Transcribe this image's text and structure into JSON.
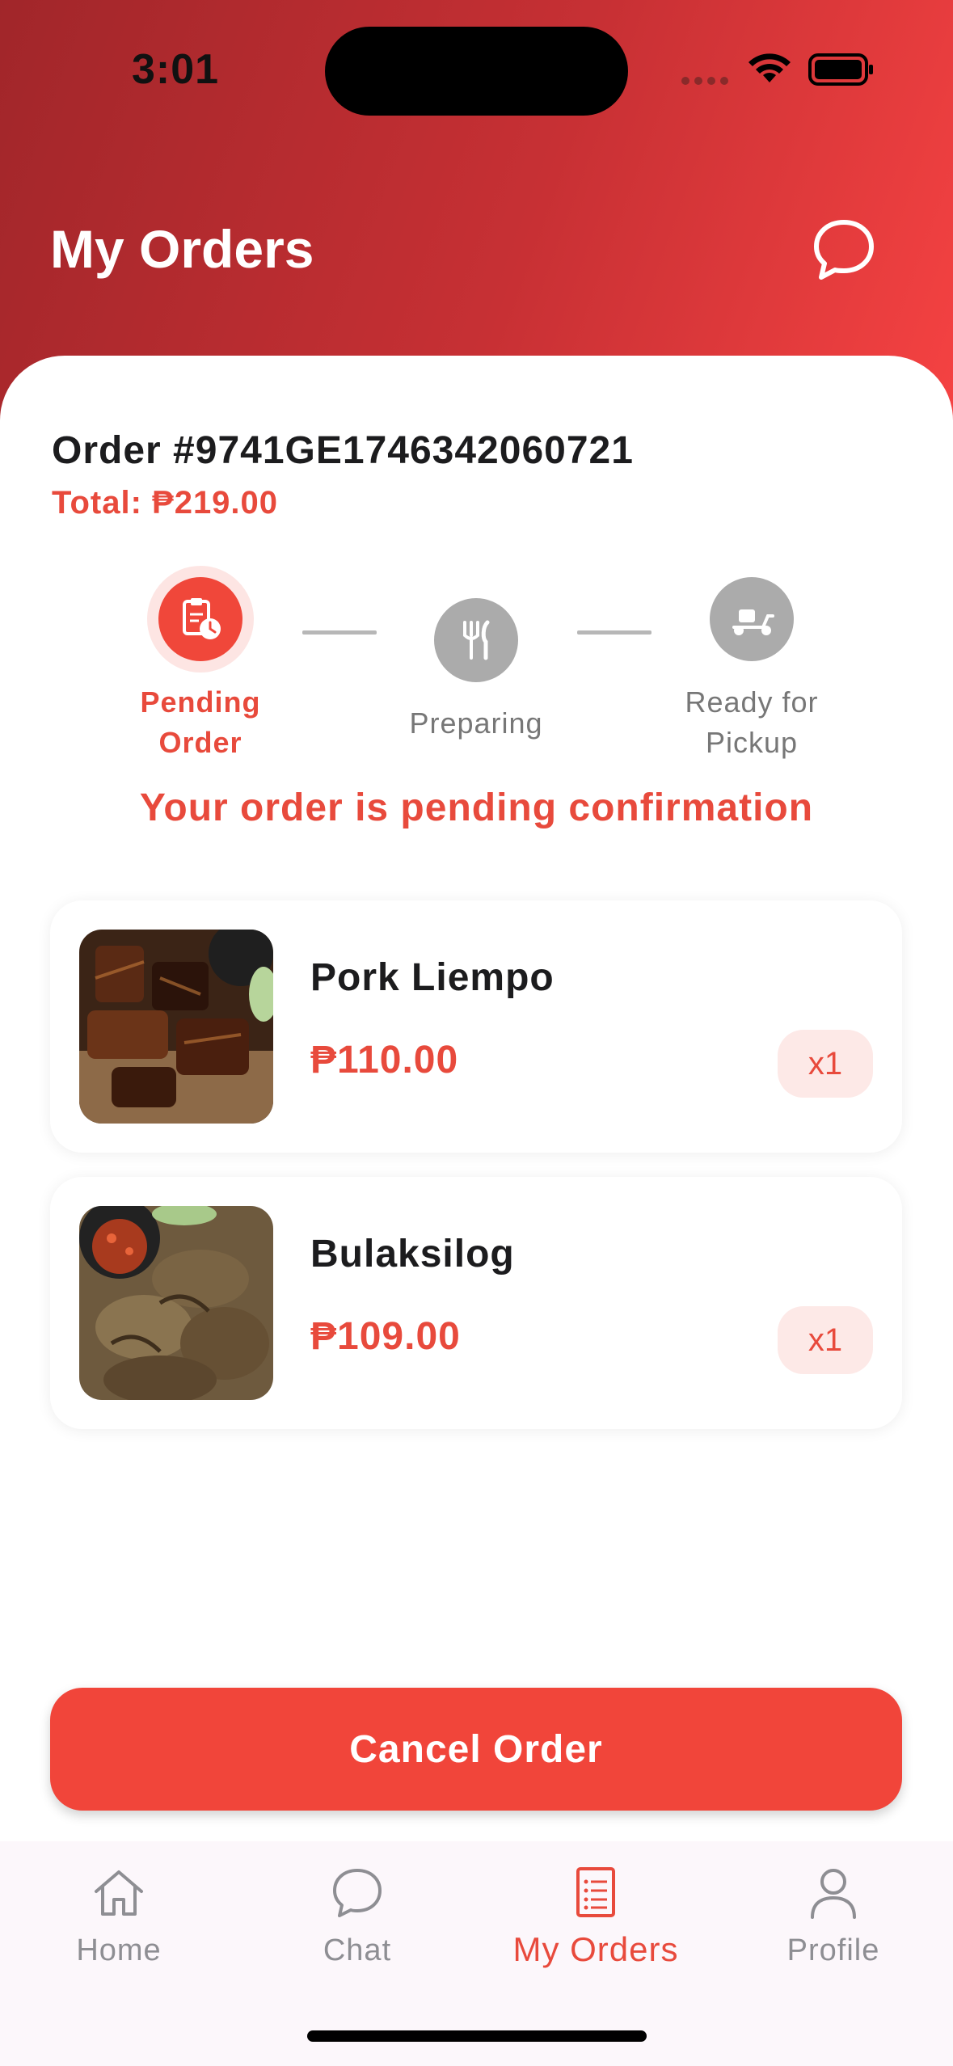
{
  "status_bar": {
    "time": "3:01"
  },
  "header": {
    "title": "My Orders",
    "chat_icon": "chat-bubble-icon"
  },
  "order": {
    "number_label": "Order #9741GE1746342060721",
    "total_label": "Total: ₱219.00"
  },
  "progress": {
    "steps": [
      {
        "label_line1": "Pending",
        "label_line2": "Order",
        "icon": "clipboard-clock-icon",
        "state": "active"
      },
      {
        "label_line1": "Preparing",
        "label_line2": "",
        "icon": "fork-knife-icon",
        "state": "idle"
      },
      {
        "label_line1": "Ready for",
        "label_line2": "Pickup",
        "icon": "scooter-icon",
        "state": "idle"
      }
    ],
    "message": "Your order is pending confirmation"
  },
  "items": [
    {
      "name": "Pork Liempo",
      "price": "₱110.00",
      "qty": "x1"
    },
    {
      "name": "Bulaksilog",
      "price": "₱109.00",
      "qty": "x1"
    }
  ],
  "actions": {
    "cancel_label": "Cancel Order"
  },
  "nav": {
    "items": [
      {
        "label": "Home",
        "icon": "home-icon",
        "active": false
      },
      {
        "label": "Chat",
        "icon": "chat-icon",
        "active": false
      },
      {
        "label": "My Orders",
        "icon": "orders-list-icon",
        "active": true
      },
      {
        "label": "Profile",
        "icon": "profile-icon",
        "active": false
      }
    ]
  },
  "colors": {
    "accent": "#f1453a",
    "header_gradient_start": "#a1262a",
    "header_gradient_end": "#f54242",
    "inactive": "#8e8e93"
  }
}
